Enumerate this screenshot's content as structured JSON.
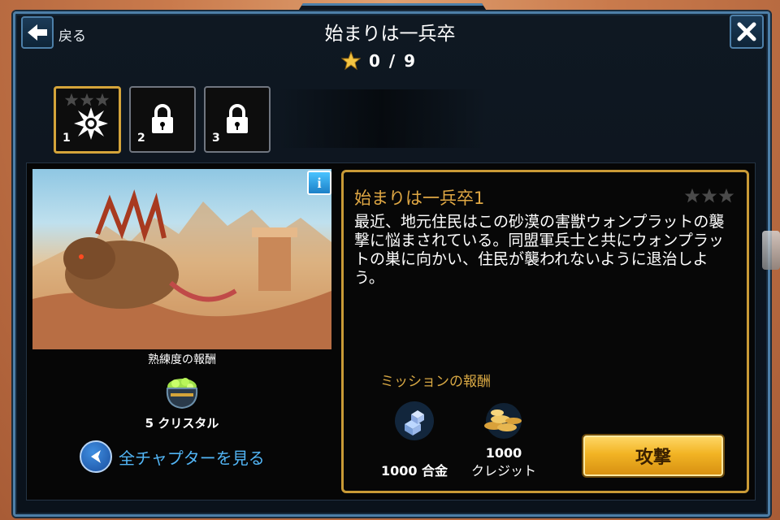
{
  "header": {
    "back_label": "戻る",
    "title": "始まりは一兵卒",
    "stars_earned": "0 / 9"
  },
  "missions": [
    {
      "number": "1",
      "state": "active",
      "stars": 0
    },
    {
      "number": "2",
      "state": "locked"
    },
    {
      "number": "3",
      "state": "locked"
    }
  ],
  "left_panel": {
    "info_button": "i",
    "mastery_reward_label": "熟練度の報酬",
    "crystal_reward": "5 クリスタル",
    "all_chapters_label": "全チャプターを見る"
  },
  "mission": {
    "title": "始まりは一兵卒1",
    "stars": 0,
    "description": "最近、地元住民はこの砂漠の害獣ウォンプラットの襲撃に悩まされている。同盟軍兵士と共にウォンプラットの巣に向かい、住民が襲われないように退治しよう。",
    "reward_heading": "ミッションの報酬",
    "alloy_reward": "1000 合金",
    "credit_amount": "1000",
    "credit_label": "クレジット",
    "attack_label": "攻撃"
  },
  "colors": {
    "frame_border": "#4d7fa8",
    "gold_accent": "#c99a36",
    "link_blue": "#52b5f5",
    "attack_button": "#f2b424"
  },
  "icons": [
    "back-arrow-icon",
    "close-icon",
    "star-icon",
    "lock-icon",
    "burst-icon",
    "crystal-pot-icon",
    "alloy-icon",
    "credits-icon",
    "info-icon"
  ]
}
